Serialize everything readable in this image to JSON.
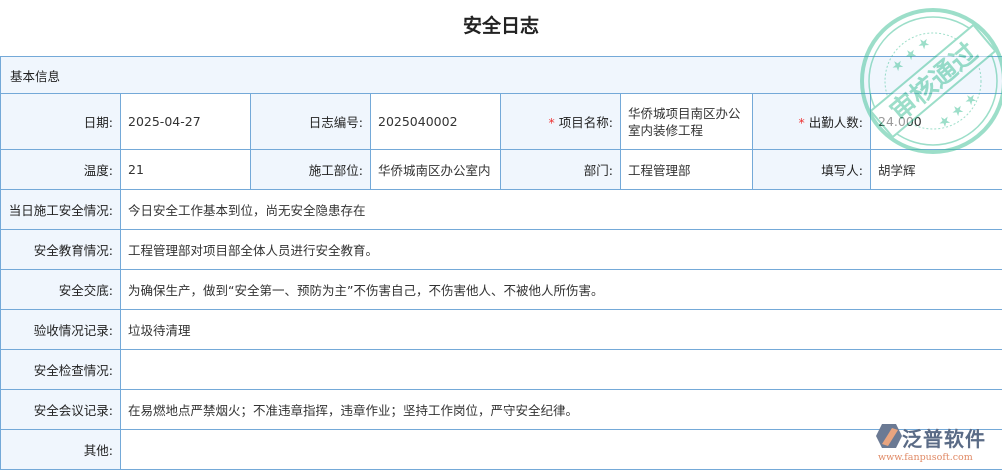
{
  "title": "安全日志",
  "section": "基本信息",
  "row1": [
    {
      "label": "日期:",
      "value": "2025-04-27"
    },
    {
      "label": "日志编号:",
      "value": "2025040002"
    },
    {
      "label": "项目名称:",
      "value": "华侨城项目南区办公室内装修工程",
      "required": true
    },
    {
      "label": "出勤人数:",
      "value": "24.000",
      "required": true
    }
  ],
  "row2": [
    {
      "label": "温度:",
      "value": "21"
    },
    {
      "label": "施工部位:",
      "value": "华侨城南区办公室内"
    },
    {
      "label": "部门:",
      "value": "工程管理部"
    },
    {
      "label": "填写人:",
      "value": "胡学辉"
    }
  ],
  "rows": [
    {
      "label": "当日施工安全情况:",
      "value": "今日安全工作基本到位，尚无安全隐患存在"
    },
    {
      "label": "安全教育情况:",
      "value": "工程管理部对项目部全体人员进行安全教育。"
    },
    {
      "label": "安全交底:",
      "value": "为确保生产，做到“安全第一、预防为主”不伤害自己，不伤害他人、不被他人所伤害。"
    },
    {
      "label": "验收情况记录:",
      "value": "垃圾待清理"
    },
    {
      "label": "安全检查情况:",
      "value": ""
    },
    {
      "label": "安全会议记录:",
      "value": "在易燃地点严禁烟火；不准违章指挥，违章作业；坚持工作岗位，严守安全纪律。"
    },
    {
      "label": "其他:",
      "value": ""
    }
  ],
  "stamp": "审核通过",
  "logo": {
    "name": "泛普软件",
    "url": "www.fanpusoft.com"
  },
  "colors": {
    "border": "#74a9d8",
    "label_bg": "#f0f6fd",
    "stamp": "#3cbf94"
  }
}
